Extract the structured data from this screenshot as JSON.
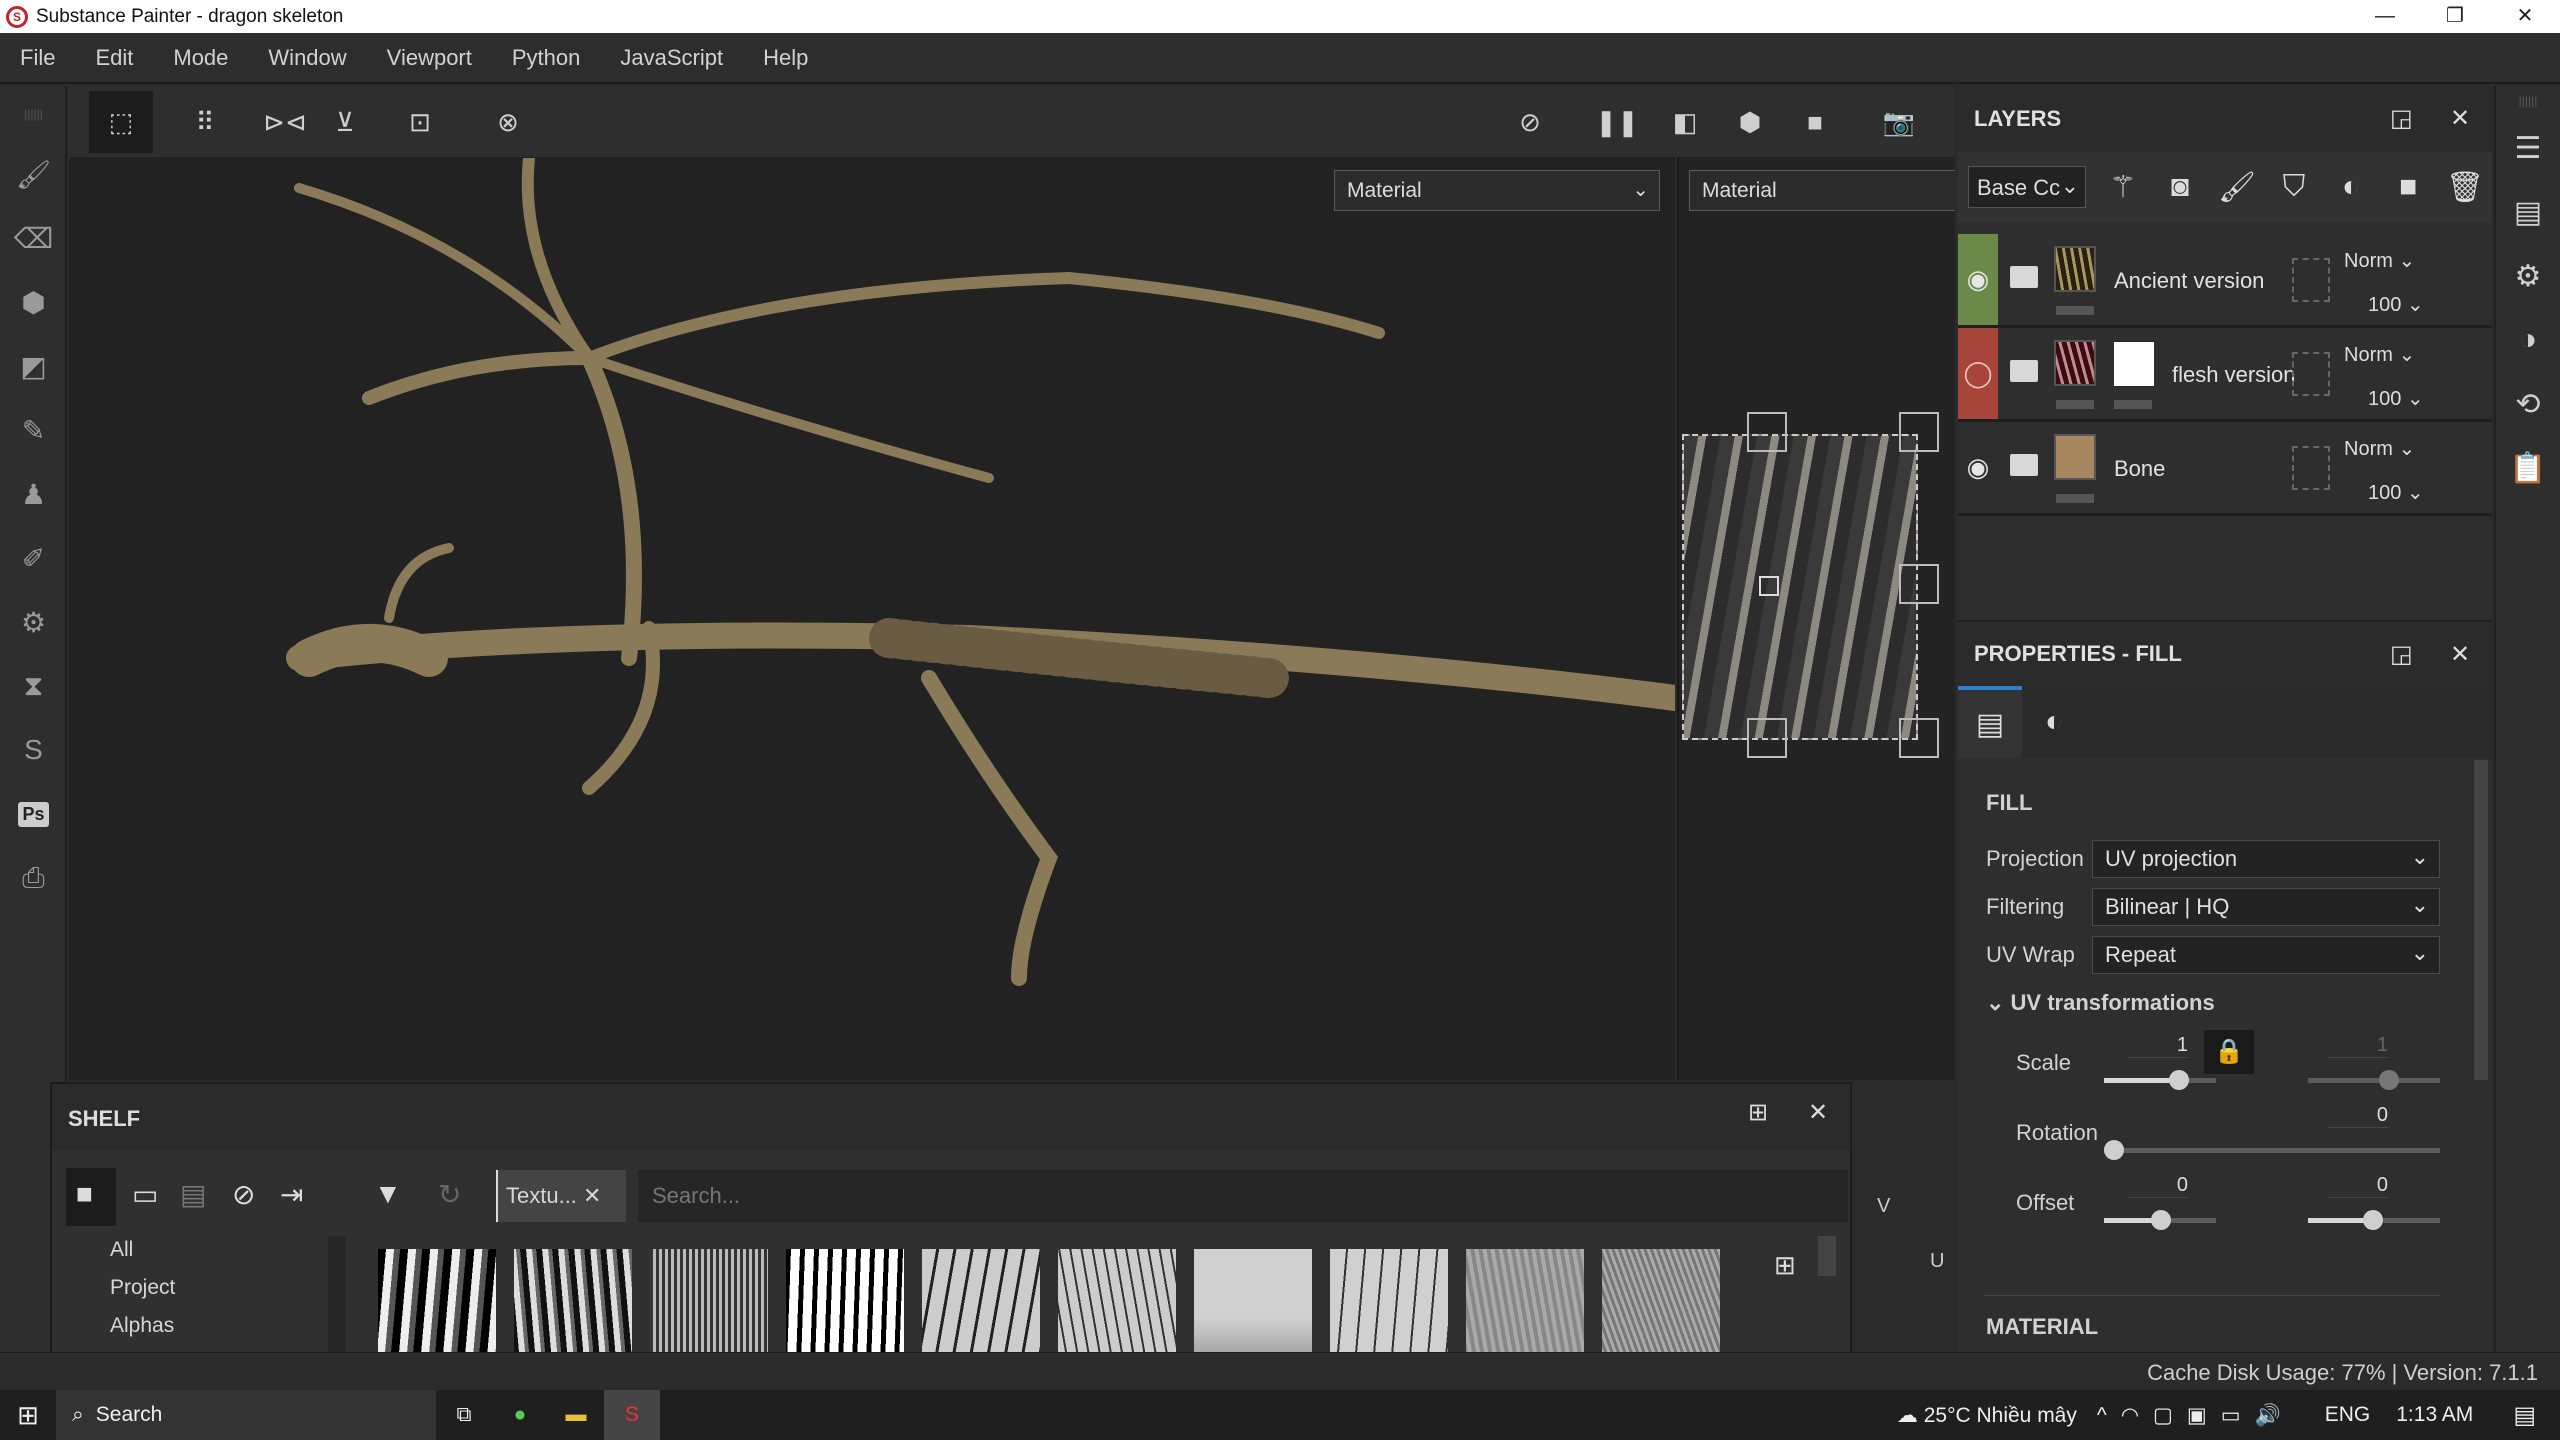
{
  "window": {
    "title": "Substance Painter - dragon skeleton",
    "minimize": "—",
    "maximize": "❐",
    "close": "✕"
  },
  "menu": [
    "File",
    "Edit",
    "Mode",
    "Window",
    "Viewport",
    "Python",
    "JavaScript",
    "Help"
  ],
  "viewport": {
    "material_left": "Material",
    "material_right": "Material",
    "axis_v": "V",
    "axis_u": "U"
  },
  "layers": {
    "title": "LAYERS",
    "channel": "Base Cc",
    "items": [
      {
        "name": "Ancient version",
        "blend": "Norm",
        "opacity": "100",
        "color": "#6b8a4a"
      },
      {
        "name": "flesh version",
        "blend": "Norm",
        "opacity": "100",
        "color": "#a8453a"
      },
      {
        "name": "Bone",
        "blend": "Norm",
        "opacity": "100",
        "color": ""
      }
    ]
  },
  "properties": {
    "title": "PROPERTIES - FILL",
    "section": "FILL",
    "projection_label": "Projection",
    "projection": "UV projection",
    "filtering_label": "Filtering",
    "filtering": "Bilinear | HQ",
    "uvwrap_label": "UV Wrap",
    "uvwrap": "Repeat",
    "uvt_label": "UV transformations",
    "scale_label": "Scale",
    "scale_u": "1",
    "scale_v": "1",
    "rotation_label": "Rotation",
    "rotation": "0",
    "offset_label": "Offset",
    "offset_u": "0",
    "offset_v": "0",
    "material_section": "MATERIAL",
    "slider_fractions": {
      "scale_u": 0.6,
      "scale_v": 0.6,
      "rotation": 0.0,
      "offset_u": 0.5,
      "offset_v": 0.5
    }
  },
  "shelf": {
    "title": "SHELF",
    "filter_tag": "Textu...",
    "search_placeholder": "Search...",
    "categories": [
      "All",
      "Project",
      "Alphas"
    ]
  },
  "status": {
    "text": "Cache Disk Usage: 77% | Version: 7.1.1"
  },
  "taskbar": {
    "search": "Search",
    "weather": "25°C  Nhiều mây",
    "lang": "ENG",
    "time": "1:13 AM"
  }
}
